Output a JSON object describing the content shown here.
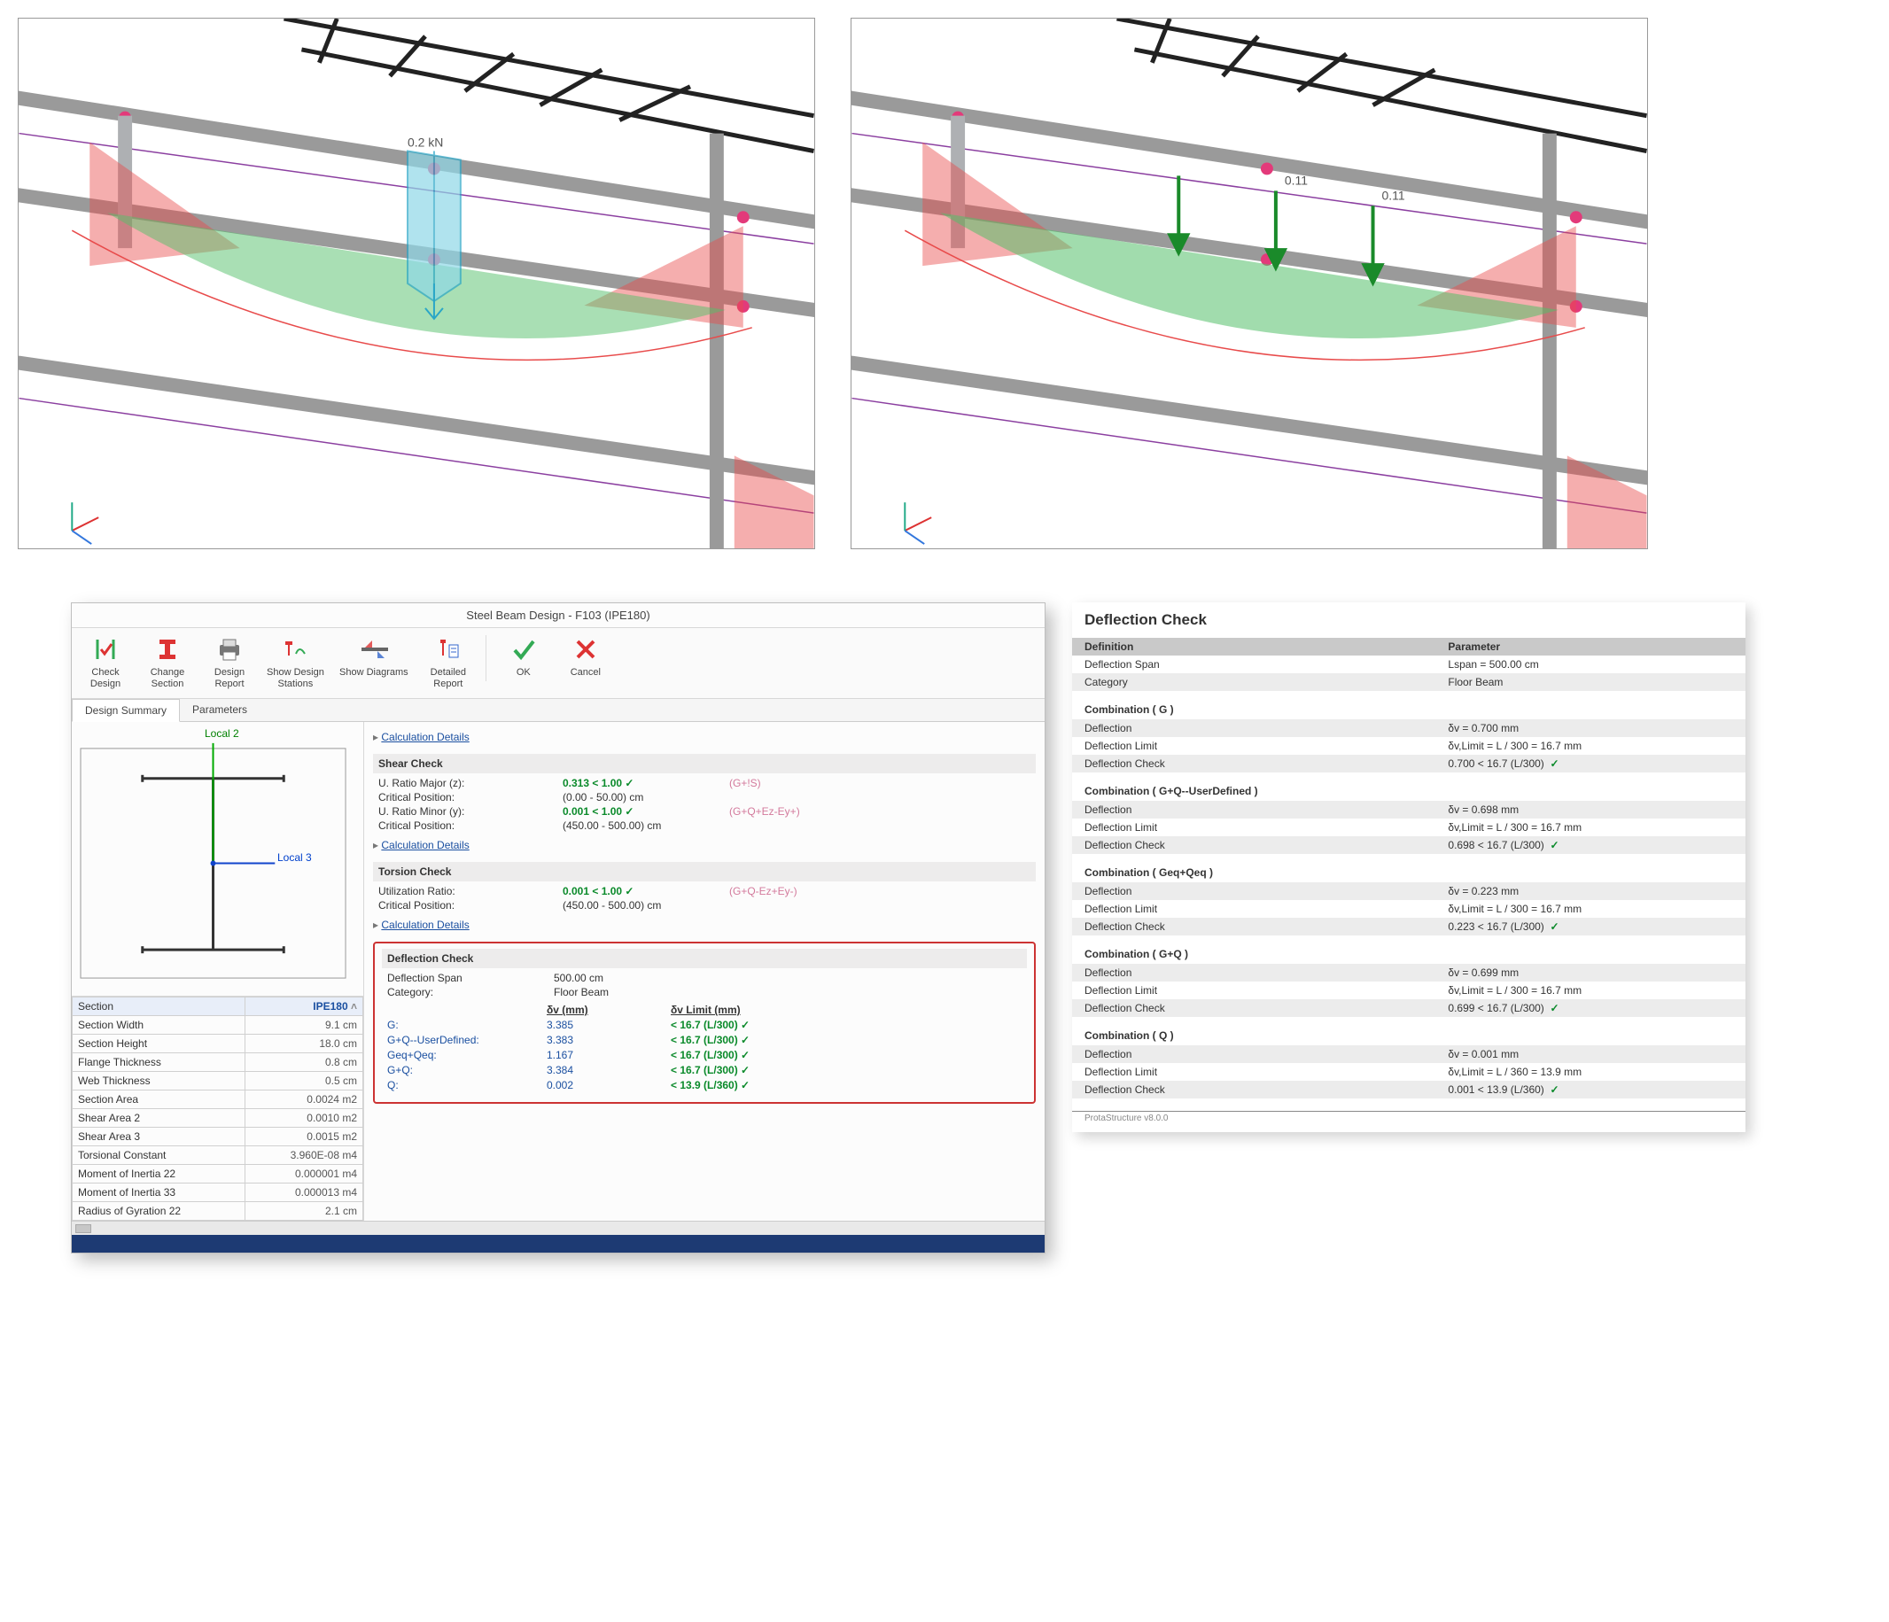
{
  "dialog": {
    "title": "Steel Beam Design - F103 (IPE180)",
    "ribbon": {
      "check_design": "Check\nDesign",
      "change_section": "Change\nSection",
      "design_report": "Design\nReport",
      "show_design_stations": "Show Design\nStations",
      "show_diagrams": "Show Diagrams",
      "detailed_report": "Detailed\nReport",
      "ok": "OK",
      "cancel": "Cancel"
    },
    "tabs": {
      "design_summary": "Design Summary",
      "parameters": "Parameters"
    },
    "local2": "Local 2",
    "local3": "Local 3",
    "calc_details": "Calculation Details",
    "section_props": [
      [
        "Section",
        "IPE180"
      ],
      [
        "Section Width",
        "9.1 cm"
      ],
      [
        "Section Height",
        "18.0 cm"
      ],
      [
        "Flange Thickness",
        "0.8 cm"
      ],
      [
        "Web Thickness",
        "0.5 cm"
      ],
      [
        "Section Area",
        "0.0024 m2"
      ],
      [
        "Shear Area 2",
        "0.0010 m2"
      ],
      [
        "Shear Area 3",
        "0.0015 m2"
      ],
      [
        "Torsional Constant",
        "3.960E-08 m4"
      ],
      [
        "Moment of Inertia 22",
        "0.000001 m4"
      ],
      [
        "Moment of Inertia 33",
        "0.000013 m4"
      ],
      [
        "Radius of Gyration 22",
        "2.1 cm"
      ]
    ],
    "shear": {
      "title": "Shear Check",
      "u_ratio_major_label": "U. Ratio Major (z):",
      "u_ratio_major_val": "0.313  < 1.00",
      "u_ratio_major_cmb": "(G+!S)",
      "crit_pos1_label": "Critical Position:",
      "crit_pos1_val": "(0.00 - 50.00) cm",
      "u_ratio_minor_label": "U. Ratio Minor (y):",
      "u_ratio_minor_val": "0.001  < 1.00",
      "u_ratio_minor_cmb": "(G+Q+Ez-Ey+)",
      "crit_pos2_label": "Critical Position:",
      "crit_pos2_val": "(450.00 - 500.00) cm"
    },
    "torsion": {
      "title": "Torsion Check",
      "ur_label": "Utilization Ratio:",
      "ur_val": "0.001  < 1.00",
      "ur_cmb": "(G+Q-Ez+Ey-)",
      "crit_label": "Critical Position:",
      "crit_val": "(450.00 - 500.00) cm"
    },
    "deflection": {
      "title": "Deflection Check",
      "span_label": "Deflection Span",
      "span_val": "500.00 cm",
      "cat_label": "Category:",
      "cat_val": "Floor Beam",
      "hd_dv": "δv (mm)",
      "hd_lim": "δv Limit (mm)",
      "rows": [
        {
          "lab": "G:",
          "val": "3.385",
          "lim": "< 16.7 (L/300) ✓"
        },
        {
          "lab": "G+Q--UserDefined:",
          "val": "3.383",
          "lim": "< 16.7 (L/300) ✓"
        },
        {
          "lab": "Geq+Qeq:",
          "val": "1.167",
          "lim": "< 16.7 (L/300) ✓"
        },
        {
          "lab": "G+Q:",
          "val": "3.384",
          "lim": "< 16.7 (L/300) ✓"
        },
        {
          "lab": "Q:",
          "val": "0.002",
          "lim": "< 13.9 (L/360) ✓"
        }
      ]
    }
  },
  "report": {
    "title": "Deflection Check",
    "hdr_def": "Definition",
    "hdr_par": "Parameter",
    "defspan_l": "Deflection Span",
    "defspan_v": "Lspan = 500.00 cm",
    "cat_l": "Category",
    "cat_v": "Floor Beam",
    "combos": [
      {
        "name": "Combination ( G )",
        "deflection": "δv = 0.700 mm",
        "limit": "δv,Limit = L / 300 = 16.7 mm",
        "check": "0.700 < 16.7 (L/300)"
      },
      {
        "name": "Combination ( G+Q--UserDefined )",
        "deflection": "δv = 0.698 mm",
        "limit": "δv,Limit = L / 300 = 16.7 mm",
        "check": "0.698 < 16.7 (L/300)"
      },
      {
        "name": "Combination ( Geq+Qeq )",
        "deflection": "δv = 0.223 mm",
        "limit": "δv,Limit = L / 300 = 16.7 mm",
        "check": "0.223 < 16.7 (L/300)"
      },
      {
        "name": "Combination ( G+Q )",
        "deflection": "δv = 0.699 mm",
        "limit": "δv,Limit = L / 300 = 16.7 mm",
        "check": "0.699 < 16.7 (L/300)"
      },
      {
        "name": "Combination ( Q )",
        "deflection": "δv = 0.001 mm",
        "limit": "δv,Limit = L / 360 = 13.9 mm",
        "check": "0.001 < 13.9 (L/360)"
      }
    ],
    "labels": {
      "deflection": "Deflection",
      "limit": "Deflection Limit",
      "check": "Deflection Check"
    },
    "footer": "ProtaStructure v8.0.0"
  }
}
